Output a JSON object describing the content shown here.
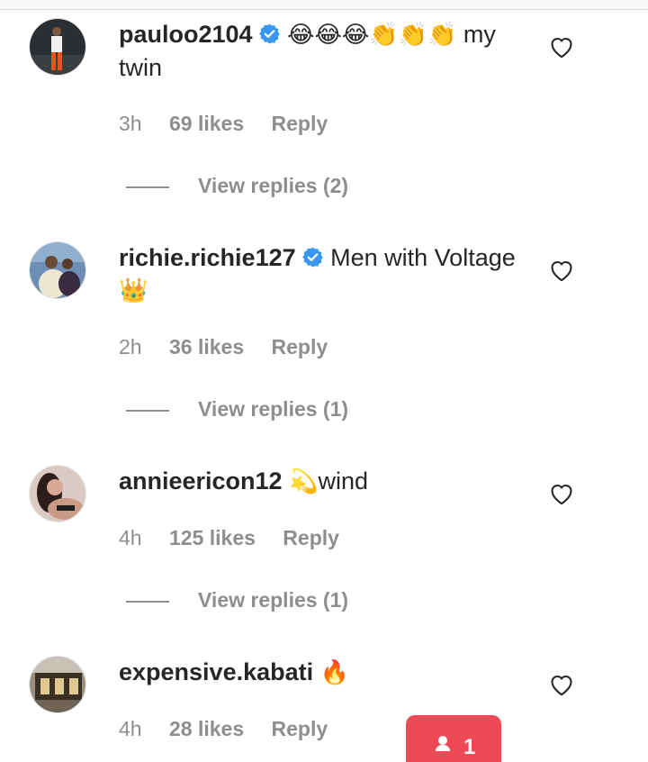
{
  "comments": [
    {
      "username": "pauloo2104",
      "verified": true,
      "text_emoji": "😂😂😂👏👏👏",
      "text": " my twin",
      "time": "3h",
      "likes": "69 likes",
      "reply": "Reply",
      "view_replies": "View replies (2)"
    },
    {
      "username": "richie.richie127",
      "verified": true,
      "text": " Men with Voltage ",
      "text_emoji": "👑",
      "time": "2h",
      "likes": "36 likes",
      "reply": "Reply",
      "view_replies": "View replies (1)"
    },
    {
      "username": "annieericon12",
      "verified": false,
      "text_emoji": "💫",
      "text": "wind",
      "time": "4h",
      "likes": "125 likes",
      "reply": "Reply",
      "view_replies": "View replies (1)"
    },
    {
      "username": "expensive.kabati",
      "verified": false,
      "text_emoji": "🔥",
      "text": "",
      "time": "4h",
      "likes": "28 likes",
      "reply": "Reply"
    }
  ],
  "notification": {
    "count": "1",
    "icon": "person-icon"
  },
  "colors": {
    "text": "#262626",
    "muted": "#8e8e8e",
    "verified": "#3897f0",
    "notification": "#ed4956"
  }
}
